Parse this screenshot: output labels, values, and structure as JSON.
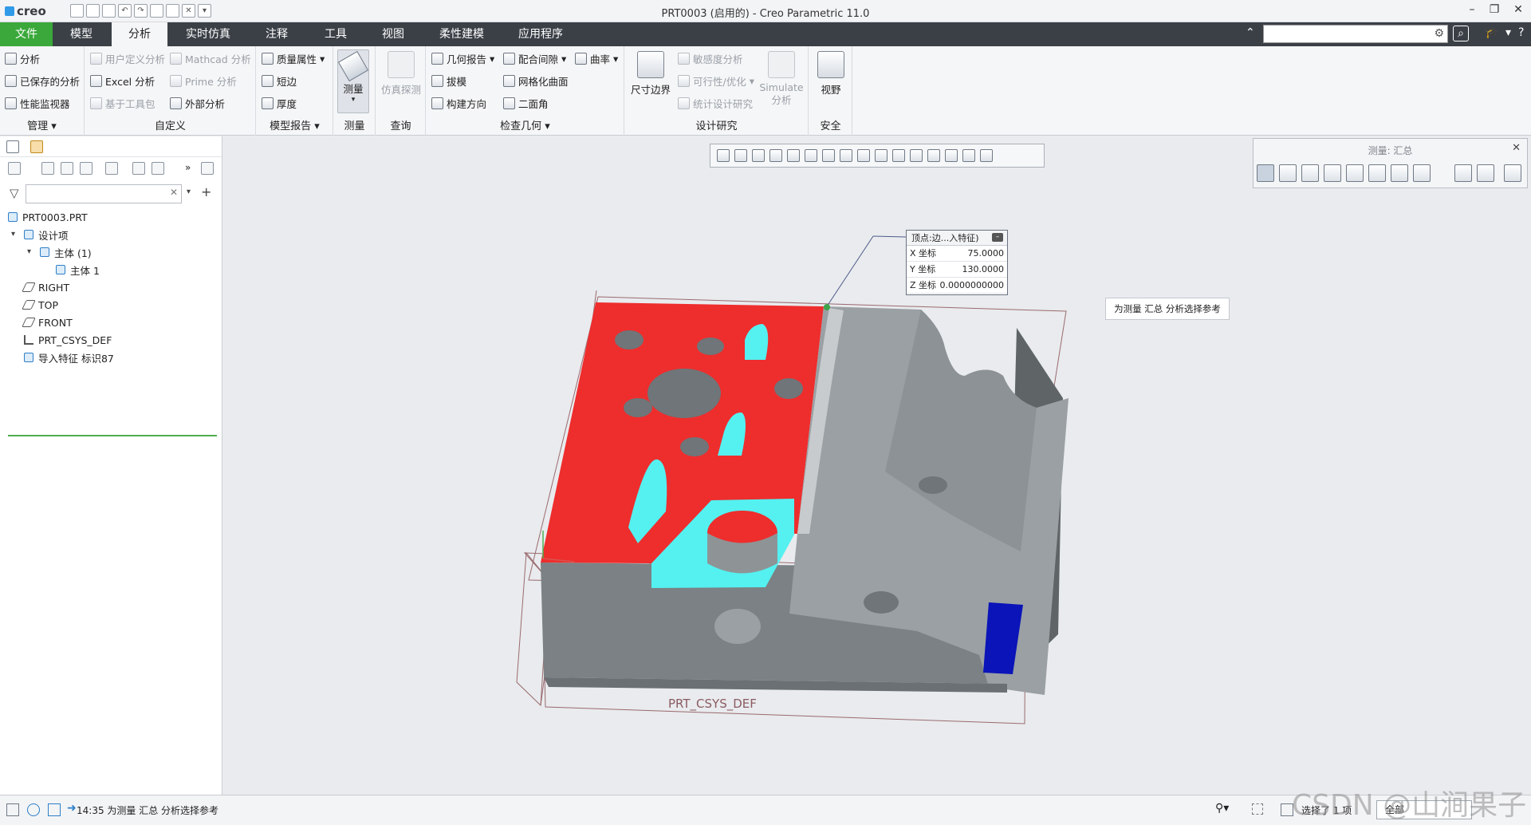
{
  "app": {
    "logo": "creo",
    "window_title": "PRT0003 (启用的) - Creo Parametric 11.0"
  },
  "tabs": [
    "文件",
    "模型",
    "分析",
    "实时仿真",
    "注释",
    "工具",
    "视图",
    "柔性建模",
    "应用程序"
  ],
  "ribbon": {
    "manage": {
      "label": "管理",
      "items": [
        "分析",
        "已保存的分析",
        "性能监视器"
      ]
    },
    "custom": {
      "label": "自定义",
      "items": [
        "用户定义分析",
        "Mathcad 分析",
        "Excel 分析",
        "Prime 分析",
        "基于工具包",
        "外部分析"
      ]
    },
    "model_report": {
      "label": "模型报告",
      "items": [
        "质量属性",
        "短边",
        "厚度"
      ]
    },
    "measure": {
      "label": "测量",
      "button": "测量"
    },
    "query": {
      "label": "查询",
      "button": "仿真探测"
    },
    "inspect": {
      "label": "检查几何",
      "items": [
        "几何报告",
        "配合间隙",
        "曲率",
        "拔模",
        "网格化曲面",
        "构建方向",
        "二面角"
      ]
    },
    "design_study": {
      "label": "设计研究",
      "items": [
        "尺寸边界",
        "敏感度分析",
        "可行性/优化",
        "统计设计研究",
        "Simulate\n分析"
      ]
    },
    "safety": {
      "label": "安全",
      "button": "视野"
    }
  },
  "tree": {
    "root": "PRT0003.PRT",
    "nodes": [
      "设计项",
      "主体 (1)",
      "主体 1",
      "RIGHT",
      "TOP",
      "FRONT",
      "PRT_CSYS_DEF",
      "导入特征 标识87"
    ]
  },
  "measure_panel": {
    "title": "测量: 汇总"
  },
  "coord_box": {
    "header": "顶点:边...入特征)",
    "x_label": "X 坐标",
    "x": "75.0000",
    "y_label": "Y 坐标",
    "y": "130.0000",
    "z_label": "Z 坐标",
    "z": "0.0000000000"
  },
  "hint": "为测量 汇总 分析选择参考",
  "csys_label": "PRT_CSYS_DEF",
  "status": {
    "message": "14:35 为测量 汇总 分析选择参考",
    "selected": "选择了 1 项",
    "filter": "全部"
  },
  "watermark": "CSDN @山涧果子",
  "colors": {
    "file_tab": "#3aa83a",
    "tabbar": "#3b4047",
    "red_face": "#ee2d2d",
    "cyan_face": "#55f0f0",
    "blue_face": "#0a14b8",
    "gray_body": "#7f8588"
  }
}
